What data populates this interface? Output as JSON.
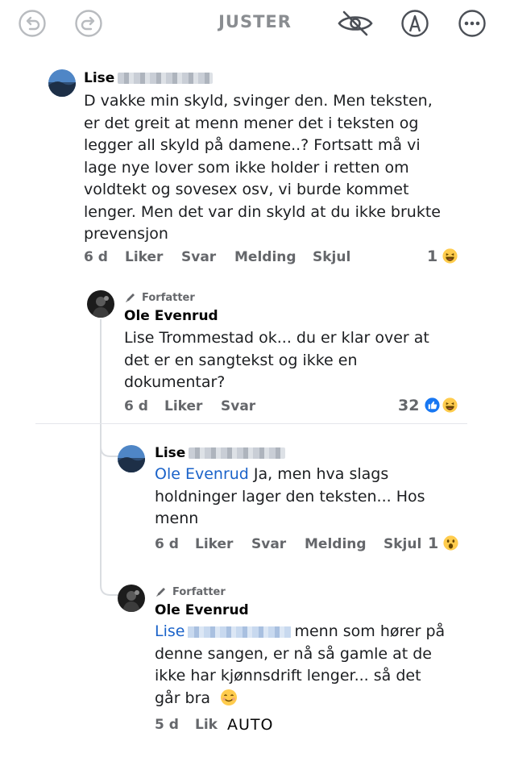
{
  "toolbar": {
    "title": "JUSTER"
  },
  "comments": [
    {
      "author": "Lise",
      "lines": [
        "D vakke min skyld, svinger den. Men teksten,",
        "er det greit at menn mener det i teksten og",
        "legger all skyld på damene..? Fortsatt må vi",
        "lage nye lover som ikke holder i retten om",
        "voldtekt og sovesex osv, vi burde kommet",
        "lenger. Men det var din skyld at du ikke brukte",
        "prevensjon"
      ],
      "time": "6 d",
      "like_label": "Liker",
      "reply_label": "Svar",
      "message_label": "Melding",
      "hide_label": "Skjul",
      "reaction_count": "1"
    },
    {
      "author_tag": "Forfatter",
      "author": "Ole Evenrud",
      "lines": [
        "Lise Trommestad ok... du er klar over at",
        "det er en sangtekst og ikke en",
        "dokumentar?"
      ],
      "time": "6 d",
      "like_label": "Liker",
      "reply_label": "Svar",
      "reaction_count": "32"
    },
    {
      "author": "Lise",
      "mention": "Ole Evenrud",
      "line1_rest": " Ja, men hva slags",
      "lines": [
        "holdninger lager den teksten... Hos",
        "menn"
      ],
      "time": "6 d",
      "like_label": "Liker",
      "reply_label": "Svar",
      "message_label": "Melding",
      "hide_label": "Skjul",
      "reaction_count": "1"
    },
    {
      "author_tag": "Forfatter",
      "author": "Ole Evenrud",
      "mention": "Lise",
      "line1_rest": "menn som hører på",
      "lines": [
        "denne sangen, er nå så gamle at de",
        "ikke har kjønnsdrift lenger... så det",
        "går bra"
      ],
      "time": "5 d",
      "like_label": "Lik"
    }
  ],
  "overlay": {
    "auto_label": "AUTO"
  },
  "colors": {
    "mention": "#1b63c9",
    "secondary_text": "#65676b",
    "like_blue": "#1877f2",
    "emoji_yellow": "#ffcc4d"
  }
}
